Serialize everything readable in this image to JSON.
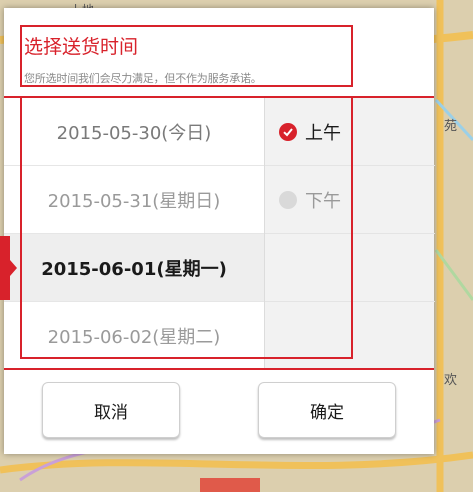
{
  "map": {
    "top_label": "上地",
    "side_labels": [
      "苑",
      "欢"
    ]
  },
  "dialog": {
    "title": "选择送货时间",
    "subtitle": "您所选时间我们会尽力满足，但不作为服务承诺。",
    "dates": [
      {
        "label": "2015-05-30(今日)",
        "state": "normal"
      },
      {
        "label": "2015-05-31(星期日)",
        "state": "faded"
      },
      {
        "label": "2015-06-01(星期一)",
        "state": "selected"
      },
      {
        "label": "2015-06-02(星期二)",
        "state": "faded"
      }
    ],
    "times": [
      {
        "label": "上午",
        "checked": true
      },
      {
        "label": "下午",
        "checked": false
      }
    ],
    "buttons": {
      "cancel": "取消",
      "confirm": "确定"
    }
  },
  "colors": {
    "accent": "#d8222b",
    "selected_bg": "#eeeeee",
    "time_panel_bg": "#f2f2f2"
  }
}
